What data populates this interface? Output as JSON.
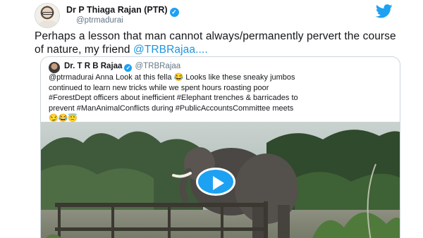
{
  "tweet": {
    "author_name": "Dr P Thiaga Rajan (PTR)",
    "author_handle": "@ptrmadurai",
    "text": "Perhaps a lesson that man cannot always/permanently pervert the course of nature, my friend ",
    "mention": "@TRBRajaa",
    "ellipsis": "....",
    "icons": {
      "verified": "verified-badge-icon",
      "logo": "twitter-bird-icon"
    },
    "colors": {
      "accent": "#1da1f2",
      "link": "#1b95e0",
      "handle": "#657786"
    }
  },
  "quoted_tweet": {
    "author_name": "Dr. T R B Rajaa",
    "author_handle": "@TRBRajaa",
    "line1": "@ptrmadurai Anna Look at this fella 😂 Looks like these sneaky jumbos",
    "line2": "continued to learn new tricks while we spent hours roasting poor",
    "line3": "#ForestDept officers about inefficient #Elephant trenches & barricades to",
    "line4": "prevent #ManAnimalConflicts during  #PublicAccountsCommittee meets",
    "emojis": "😏😂😇",
    "media": {
      "type": "video",
      "play_icon": "play-button-icon"
    }
  }
}
